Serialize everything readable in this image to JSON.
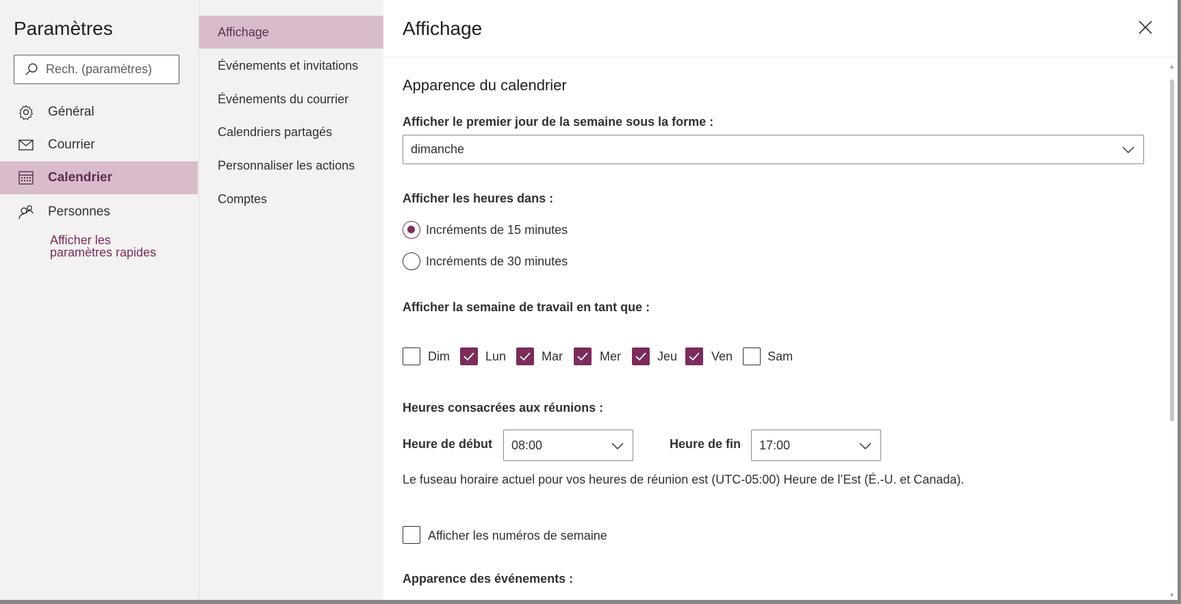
{
  "left_nav": {
    "title": "Paramètres",
    "search": {
      "placeholder": "Rech. (paramètres)",
      "icon": "search-icon"
    },
    "items": [
      {
        "label": "Général",
        "icon": "gear-icon",
        "selected": false
      },
      {
        "label": "Courrier",
        "icon": "mail-icon",
        "selected": false
      },
      {
        "label": "Calendrier",
        "icon": "calendar-icon",
        "selected": true
      },
      {
        "label": "Personnes",
        "icon": "people-icon",
        "selected": false
      }
    ],
    "quick_settings_line1": "Afficher les",
    "quick_settings_line2": "paramètres rapides"
  },
  "sub_nav": {
    "items": [
      {
        "label": "Affichage",
        "selected": true
      },
      {
        "label": "Événements et invitations",
        "selected": false
      },
      {
        "label": "Événements du courrier",
        "selected": false
      },
      {
        "label": "Calendriers partagés",
        "selected": false
      },
      {
        "label": "Personnaliser les actions",
        "selected": false
      },
      {
        "label": "Comptes",
        "selected": false
      }
    ]
  },
  "content": {
    "title": "Affichage",
    "close_icon": "close-icon",
    "section_title": "Apparence du calendrier",
    "first_day": {
      "label": "Afficher le premier jour de la semaine sous la forme :",
      "value": "dimanche"
    },
    "time_scale": {
      "label": "Afficher les heures dans :",
      "options": [
        {
          "label": "Incréments de 15 minutes",
          "selected": true
        },
        {
          "label": "Incréments de 30 minutes",
          "selected": false
        }
      ]
    },
    "work_week": {
      "label": "Afficher la semaine de travail en tant que :",
      "days": [
        {
          "label": "Dim",
          "checked": false
        },
        {
          "label": "Lun",
          "checked": true
        },
        {
          "label": "Mar",
          "checked": true
        },
        {
          "label": "Mer",
          "checked": true
        },
        {
          "label": "Jeu",
          "checked": true
        },
        {
          "label": "Ven",
          "checked": true
        },
        {
          "label": "Sam",
          "checked": false
        }
      ]
    },
    "meeting_hours": {
      "label": "Heures consacrées aux réunions :",
      "start_label": "Heure de début",
      "start_value": "08:00",
      "end_label": "Heure de fin",
      "end_value": "17:00",
      "timezone_note": "Le fuseau horaire actuel pour vos heures de réunion est (UTC-05:00) Heure de l’Est (É.-U. et Canada)."
    },
    "week_numbers": {
      "label": "Afficher les numéros de semaine",
      "checked": false
    },
    "event_appearance_label": "Apparence des événements :"
  },
  "colors": {
    "accent": "#7b2c5c",
    "selected_bg": "#d9bccc",
    "nav_bg": "#f3f2f1"
  }
}
